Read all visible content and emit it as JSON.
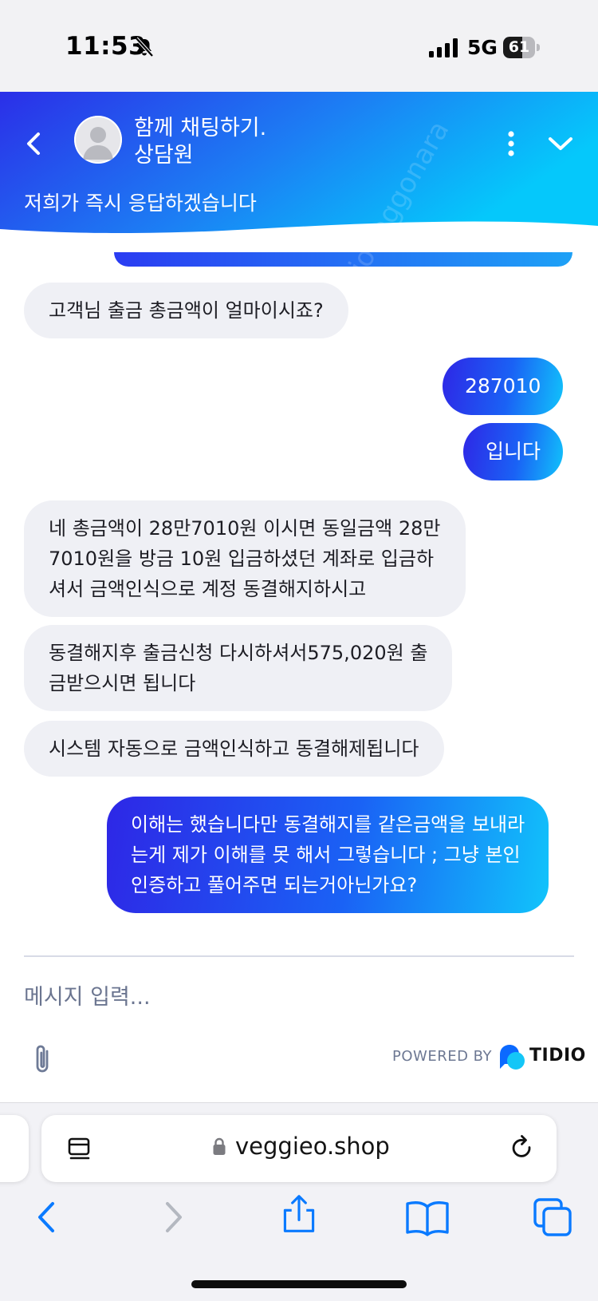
{
  "status_bar": {
    "time": "11:53",
    "network": "5G",
    "battery": 61,
    "icons": [
      "bell-slash-icon",
      "cellular-signal-icon",
      "battery-icon"
    ]
  },
  "header": {
    "title": "함께 채팅하기.",
    "agent_role": "상담원",
    "subtitle": "저희가 즉시 응답하겠습니다",
    "icons": [
      "chevron-left-icon",
      "avatar-placeholder-icon",
      "more-vertical-icon",
      "chevron-down-icon"
    ],
    "gradient": [
      "#2b2fe8",
      "#1c7ff4",
      "#05c8fb"
    ]
  },
  "messages": [
    {
      "from": "agent",
      "text": "고객님 출금 총금액이 얼마이시죠?"
    },
    {
      "from": "user",
      "text": "287010"
    },
    {
      "from": "user",
      "text": "입니다"
    },
    {
      "from": "agent",
      "lines": [
        "네 총금액이 28만7010원 이시면 동일금액 28만",
        "7010원을 방금 10원 입금하셨던 계좌로 입금하",
        "셔서 금액인식으로 계정 동결해지하시고"
      ]
    },
    {
      "from": "agent",
      "lines": [
        "동결해지후 출금신청 다시하셔서575,020원 출",
        "금받으시면 됩니다"
      ]
    },
    {
      "from": "agent",
      "text": "시스템 자동으로 금액인식하고 동결해제됩니다"
    },
    {
      "from": "user",
      "lines": [
        "이해는 했습니다만 동결해지를 같은금액을 보내라",
        "는게 제가 이해를 못 해서 그렇습니다 ; 그냥 본인",
        "인증하고 풀어주면 되는거아닌가요?"
      ]
    }
  ],
  "composer": {
    "placeholder": "메시지 입력...",
    "powered_by": "POWERED BY",
    "brand": "TIDIO",
    "icons": [
      "paperclip-icon",
      "tidio-logo-icon"
    ]
  },
  "browser": {
    "url": "veggieo.shop",
    "icons": [
      "reader-mode-icon",
      "lock-icon",
      "reload-icon",
      "back-arrow-icon",
      "forward-arrow-icon",
      "share-icon",
      "bookmarks-icon",
      "tabs-icon"
    ],
    "accent": "#0a7aff"
  },
  "watermark": "joonggonara"
}
